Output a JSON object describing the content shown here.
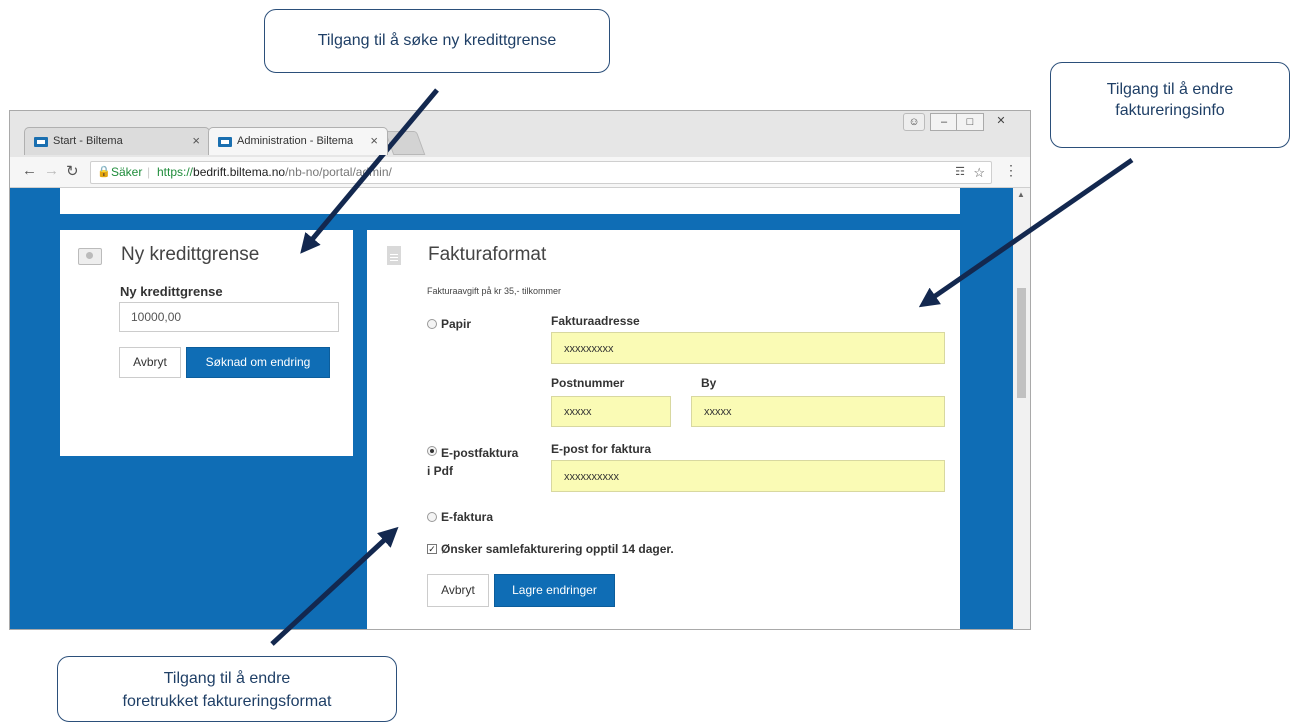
{
  "browser": {
    "tabs": [
      {
        "title": "Start - Biltema",
        "close": "×"
      },
      {
        "title": "Administration - Biltema",
        "close": "×"
      }
    ],
    "url_secure_label": "Säker",
    "url_prefix": "https://",
    "url_domain": "bedrift.biltema.no",
    "url_path": "/nb-no/portal/admin/"
  },
  "credit_card": {
    "title": "Ny kredittgrense",
    "field_label": "Ny kredittgrense",
    "field_value": "10000,00",
    "cancel_label": "Avbryt",
    "submit_label": "Søknad om endring"
  },
  "invoice_card": {
    "title": "Fakturaformat",
    "fee_note": "Fakturaavgift på kr 35,- tilkommer",
    "options": {
      "paper": "Papir",
      "email_pdf_line1": "E-postfaktura",
      "email_pdf_line2": "i Pdf",
      "efaktura": "E-faktura"
    },
    "address_label": "Fakturaadresse",
    "address_value": "xxxxxxxxx",
    "postnr_label": "Postnummer",
    "postnr_value": "xxxxx",
    "city_label": "By",
    "city_value": "xxxxx",
    "email_label": "E-post for faktura",
    "email_value": "xxxxxxxxxx",
    "collective_label": "Ønsker samlefakturering opptil 14 dager.",
    "cancel_label": "Avbryt",
    "save_label": "Lagre endringer"
  },
  "callouts": {
    "top": "Tilgang til å søke ny kredittgrense",
    "right_line1": "Tilgang til å endre",
    "right_line2": "faktureringsinfo",
    "bottom_line1": "Tilgang til å endre",
    "bottom_line2": "foretrukket faktureringsformat"
  },
  "colors": {
    "brand_blue": "#0f6db5",
    "field_highlight": "#fafbb5",
    "arrow": "#13284f"
  }
}
